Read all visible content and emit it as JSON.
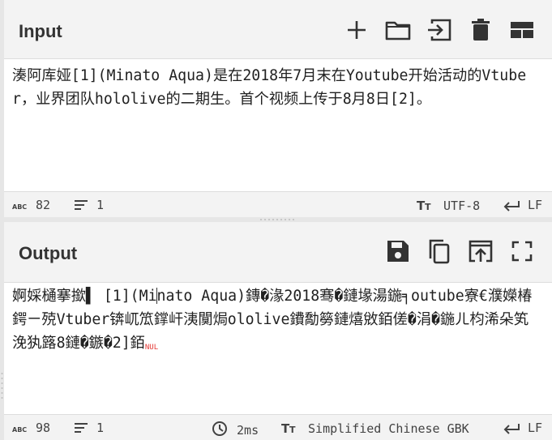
{
  "input": {
    "title": "Input",
    "text": "湊阿库娅[1](Minato Aqua)是在2018年7月末在Youtube开始活动的Vtuber，业界团队hololive的二期生。首个视频上传于8月8日[2]。",
    "status": {
      "chars": "82",
      "lines": "1",
      "encoding": "UTF-8",
      "eol": "LF"
    },
    "toolbar": [
      "add-icon",
      "folder-icon",
      "import-icon",
      "delete-icon",
      "layout-icon"
    ]
  },
  "output": {
    "title": "Output",
    "text_a": "婀婇樋搴撳▌ [1](Mi",
    "text_b": "nato Aqua)鏄�湪2018骞�鏈堟湯鍦╕outube寮€濮嬫椿鍔ㄧ殑Vtuber锛屼笟鐣屽洟闃焗ololive鐨勪簩鏈熺敓銆傞�涓�鍦ㄦ枃浠朵笂浼犱簬8鏈�鏃�2]銆",
    "nul_label": "NUL",
    "status": {
      "chars": "98",
      "lines": "1",
      "time": "2ms",
      "encoding": "Simplified Chinese GBK",
      "eol": "LF"
    },
    "toolbar": [
      "save-icon",
      "copy-icon",
      "replace-input-icon",
      "maximise-icon"
    ]
  },
  "colors": {
    "header_bg": "#f3f3f3",
    "panel_bg": "#ffffff",
    "gutter": "#e6e6e6",
    "nul": "#e53935",
    "icon": "#333333"
  }
}
